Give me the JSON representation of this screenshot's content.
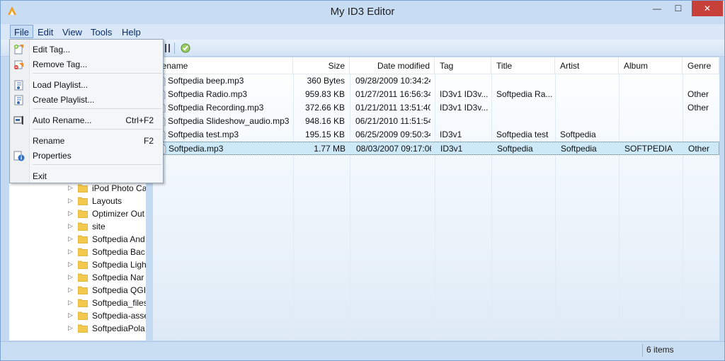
{
  "window": {
    "title": "My ID3 Editor",
    "minimize_glyph": "—",
    "maximize_glyph": "☐",
    "close_glyph": "✕"
  },
  "menubar": [
    "File",
    "Edit",
    "View",
    "Tools",
    "Help"
  ],
  "file_menu": {
    "items": [
      {
        "label": "Edit Tag...",
        "shortcut": "",
        "icon": "edit-tag-icon"
      },
      {
        "label": "Remove Tag...",
        "shortcut": "",
        "icon": "remove-tag-icon"
      },
      {
        "label": "Load Playlist...",
        "shortcut": "",
        "icon": "load-playlist-icon"
      },
      {
        "label": "Create Playlist...",
        "shortcut": "",
        "icon": "create-playlist-icon"
      },
      {
        "label": "Auto Rename...",
        "shortcut": "Ctrl+F2",
        "icon": "auto-rename-icon"
      },
      {
        "label": "Rename",
        "shortcut": "F2",
        "icon": ""
      },
      {
        "label": "Properties",
        "shortcut": "",
        "icon": "properties-icon"
      },
      {
        "label": "Exit",
        "shortcut": "",
        "icon": ""
      }
    ]
  },
  "tree": {
    "items": [
      "iPod Photo Ca",
      "Layouts",
      "Optimizer Out",
      "site",
      "Softpedia And",
      "Softpedia Bac",
      "Softpedia Ligh",
      "Softpedia Nar",
      "Softpedia QGI",
      "Softpedia_files",
      "Softpedia-asse",
      "SoftpediaPola"
    ]
  },
  "list": {
    "columns": [
      "lename",
      "Size",
      "Date modified",
      "Tag",
      "Title",
      "Artist",
      "Album",
      "Genre"
    ],
    "rows": [
      {
        "name": "Softpedia beep.mp3",
        "size": "360 Bytes",
        "date": "09/28/2009 10:34:24",
        "tag": "",
        "title": "",
        "artist": "",
        "album": "",
        "genre": ""
      },
      {
        "name": "Softpedia Radio.mp3",
        "size": "959.83 KB",
        "date": "01/27/2011 16:56:34",
        "tag": "ID3v1 ID3v...",
        "title": "Softpedia Ra...",
        "artist": "",
        "album": "",
        "genre": "Other"
      },
      {
        "name": "Softpedia Recording.mp3",
        "size": "372.66 KB",
        "date": "01/21/2011 13:51:40",
        "tag": "ID3v1 ID3v...",
        "title": "",
        "artist": "",
        "album": "",
        "genre": "Other"
      },
      {
        "name": "Softpedia Slideshow_audio.mp3",
        "size": "948.16 KB",
        "date": "06/21/2010 11:51:54",
        "tag": "",
        "title": "",
        "artist": "",
        "album": "",
        "genre": ""
      },
      {
        "name": "Softpedia test.mp3",
        "size": "195.15 KB",
        "date": "06/25/2009 09:50:34",
        "tag": "ID3v1",
        "title": "Softpedia test",
        "artist": "Softpedia",
        "album": "",
        "genre": ""
      },
      {
        "name": "Softpedia.mp3",
        "size": "1.77 MB",
        "date": "08/03/2007 09:17:06",
        "tag": "ID3v1",
        "title": "Softpedia",
        "artist": "Softpedia",
        "album": "SOFTPEDIA",
        "genre": "Other"
      }
    ],
    "selected_index": 5
  },
  "status": {
    "count": "6 items"
  },
  "colors": {
    "accent": "#3a6ea5",
    "selection": "#cde8f7",
    "close": "#c7403a"
  }
}
